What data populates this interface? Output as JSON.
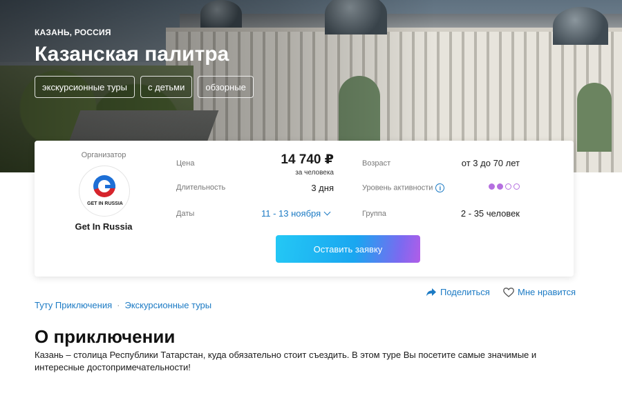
{
  "hero": {
    "location": "КАЗАНЬ, РОССИЯ",
    "title": "Казанская палитра",
    "tags": [
      "экскурсионные туры",
      "с детьми",
      "обзорные"
    ]
  },
  "card": {
    "organizer": {
      "label": "Организатор",
      "logo_text": "GET IN RUSSIA",
      "name": "Get In Russia"
    },
    "price": {
      "label": "Цена",
      "value": "14 740 ₽",
      "note": "за человека"
    },
    "duration": {
      "label": "Длительность",
      "value": "3 дня"
    },
    "dates": {
      "label": "Даты",
      "value": "11 - 13 ноября"
    },
    "age": {
      "label": "Возраст",
      "value": "от 3 до 70 лет"
    },
    "activity": {
      "label": "Уровень активности",
      "info_icon": "i",
      "level": 2,
      "max": 4
    },
    "group": {
      "label": "Группа",
      "value": "2 - 35 человек"
    },
    "cta_label": "Оставить заявку"
  },
  "actions": {
    "share": "Поделиться",
    "like": "Мне нравится"
  },
  "breadcrumbs": [
    "Туту Приключения",
    "Экскурсионные туры"
  ],
  "breadcrumb_separator": "·",
  "about": {
    "title": "О приключении",
    "text": "Казань – столица Республики Татарстан, куда обязательно стоит съездить. В этом туре Вы посетите самые значимые и интересные достопримечательности!"
  },
  "colors": {
    "link": "#1b7ac4",
    "activity_dot": "#b570e0",
    "cta_start": "#24c8f5",
    "cta_end": "#b25de8"
  }
}
